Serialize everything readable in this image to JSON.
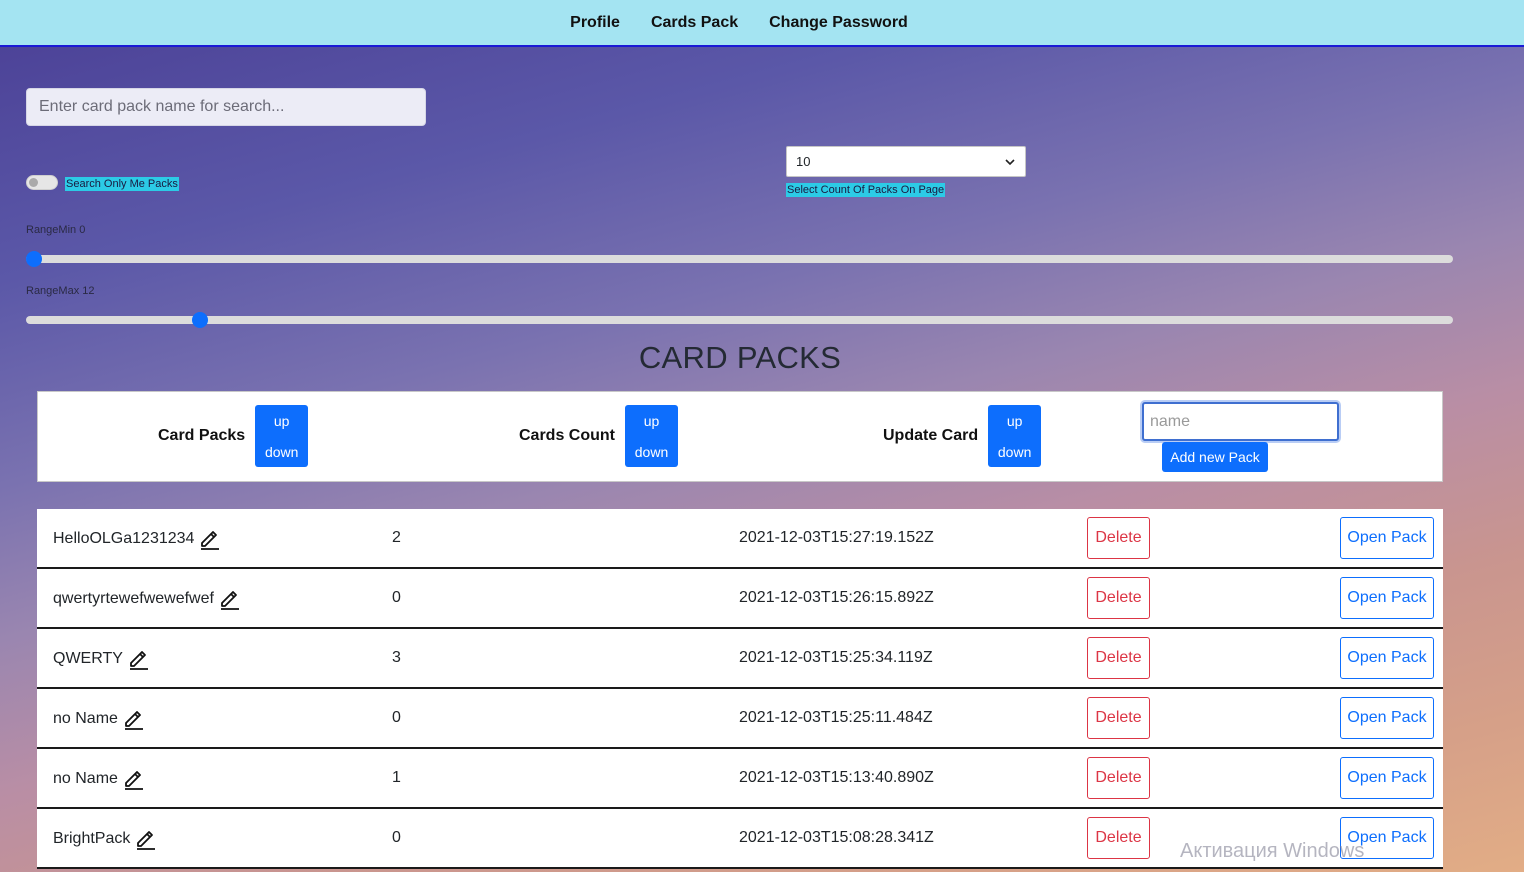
{
  "nav": [
    "Profile",
    "Cards Pack",
    "Change Password"
  ],
  "search": {
    "placeholder": "Enter card pack name for search..."
  },
  "filters": {
    "only_me_label": "Search Only Me Packs",
    "count_select_value": "10",
    "count_select_label": "Select Count Of Packs On Page"
  },
  "range": {
    "min_label": "RangeMin 0",
    "max_label": "RangeMax 12",
    "min_value": 0,
    "max_value": 12,
    "scale_max": 102
  },
  "heading": "CARD PACKS",
  "table_header": {
    "col_name": "Card Packs",
    "col_count": "Cards Count",
    "col_updated": "Update Card",
    "up_label": "up",
    "down_label": "down",
    "name_placeholder": "name",
    "add_label": "Add new Pack"
  },
  "row_actions": {
    "delete_label": "Delete",
    "open_label": "Open Pack"
  },
  "packs": [
    {
      "name": "HelloOLGa1231234",
      "count": "2",
      "updated": "2021-12-03T15:27:19.152Z"
    },
    {
      "name": "qwertyrtewefwewefwef",
      "count": "0",
      "updated": "2021-12-03T15:26:15.892Z"
    },
    {
      "name": "QWERTY",
      "count": "3",
      "updated": "2021-12-03T15:25:34.119Z"
    },
    {
      "name": "no Name",
      "count": "0",
      "updated": "2021-12-03T15:25:11.484Z"
    },
    {
      "name": "no Name",
      "count": "1",
      "updated": "2021-12-03T15:13:40.890Z"
    },
    {
      "name": "BrightPack",
      "count": "0",
      "updated": "2021-12-03T15:08:28.341Z"
    }
  ],
  "watermark": "Активация Windows",
  "colors": {
    "primary": "#0d6efd",
    "danger": "#dc3545",
    "topbar": "#a4e4f2",
    "highlight": "#2ccbe6"
  }
}
